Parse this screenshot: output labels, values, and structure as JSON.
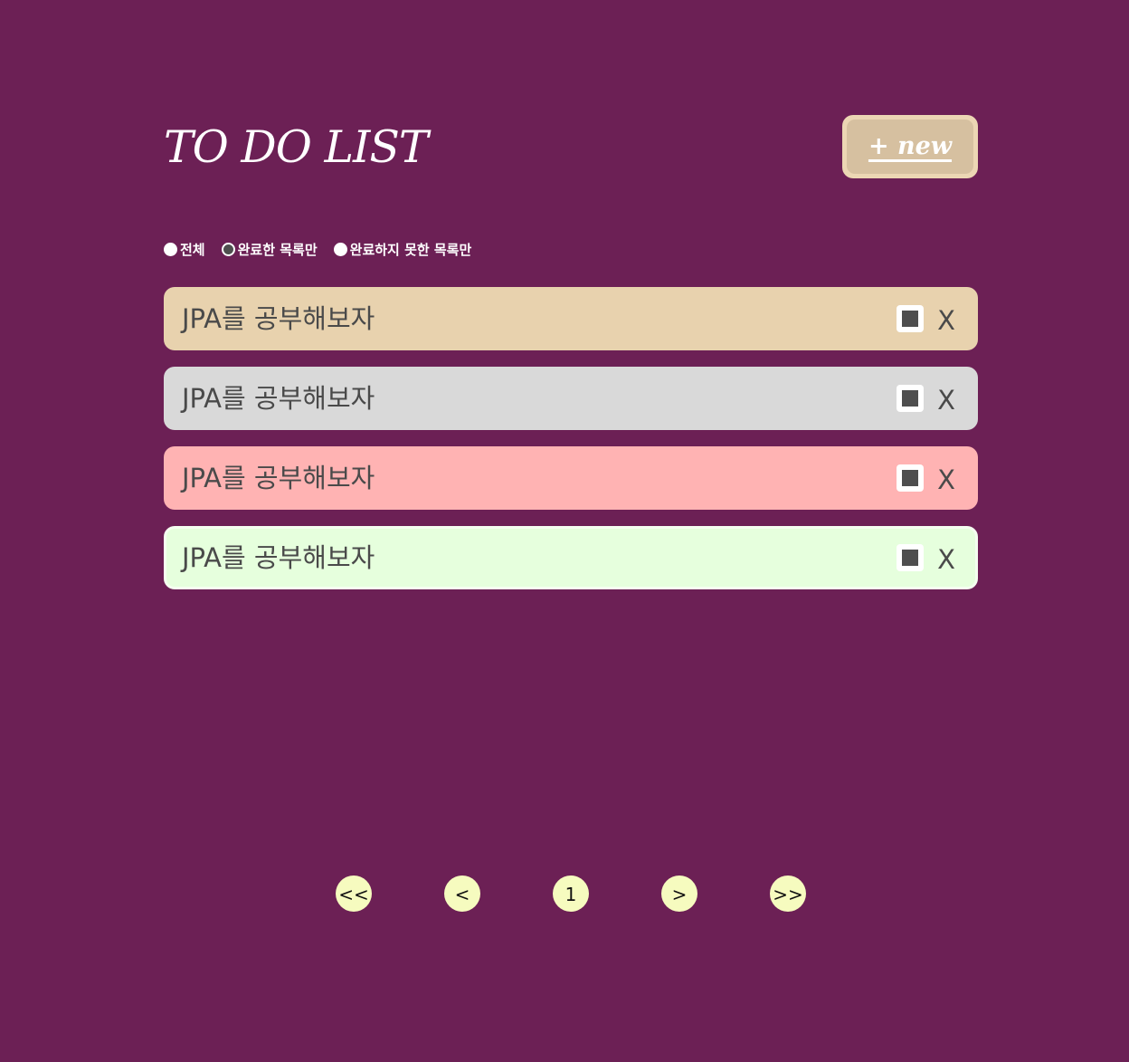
{
  "header": {
    "title": "TO DO LIST",
    "new_button_label": "+ new"
  },
  "filters": [
    {
      "label": "전체",
      "selected": false
    },
    {
      "label": "완료한 목록만",
      "selected": true
    },
    {
      "label": "완료하지 못한 목록만",
      "selected": false
    }
  ],
  "todos": [
    {
      "text": "JPA를 공부해보자",
      "color": "#e8d2ae",
      "delete_label": "X"
    },
    {
      "text": "JPA를 공부해보자",
      "color": "#d9d9d9",
      "delete_label": "X"
    },
    {
      "text": "JPA를 공부해보자",
      "color": "#ffb3b3",
      "delete_label": "X"
    },
    {
      "text": "JPA를 공부해보자",
      "color": "#e6ffdd",
      "delete_label": "X"
    }
  ],
  "pagination": {
    "first_label": "<<",
    "prev_label": "<",
    "current_page": "1",
    "next_label": ">",
    "last_label": ">>"
  },
  "colors": {
    "background": "#6c2055",
    "new_button_outer": "#ecd6b4",
    "new_button_inner": "#d6c0a0",
    "page_button": "#f6fbbf"
  }
}
